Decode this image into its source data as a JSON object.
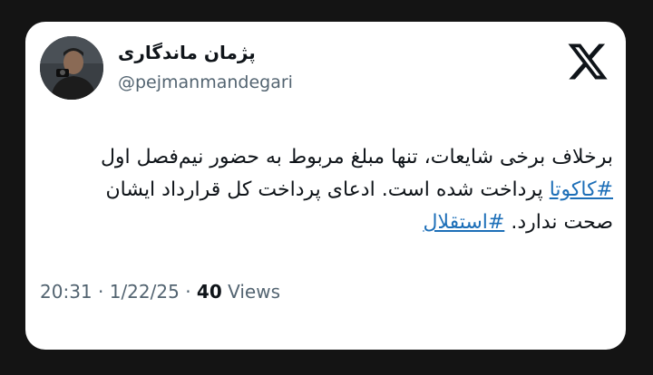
{
  "author": {
    "display_name": "پژمان ماندگاری",
    "handle": "@pejmanmandegari"
  },
  "brand_icon": "x-logo-icon",
  "tweet": {
    "text_part1": "برخلاف برخی شایعات، تنها مبلغ مربوط به حضور نیم‌فصل اول ",
    "hashtag1": "#کاکوتا",
    "text_part2": " پرداخت شده است. ادعای پرداخت کل قرارداد ایشان صحت ندارد. ",
    "hashtag2": "#استقلال"
  },
  "meta": {
    "time": "20:31",
    "separator": "·",
    "date": "1/22/25",
    "views_count": "40",
    "views_label": "Views"
  },
  "colors": {
    "background": "#141414",
    "card": "#ffffff",
    "text": "#0f1419",
    "secondary_text": "#536471",
    "hashtag": "#1d6fb8"
  }
}
